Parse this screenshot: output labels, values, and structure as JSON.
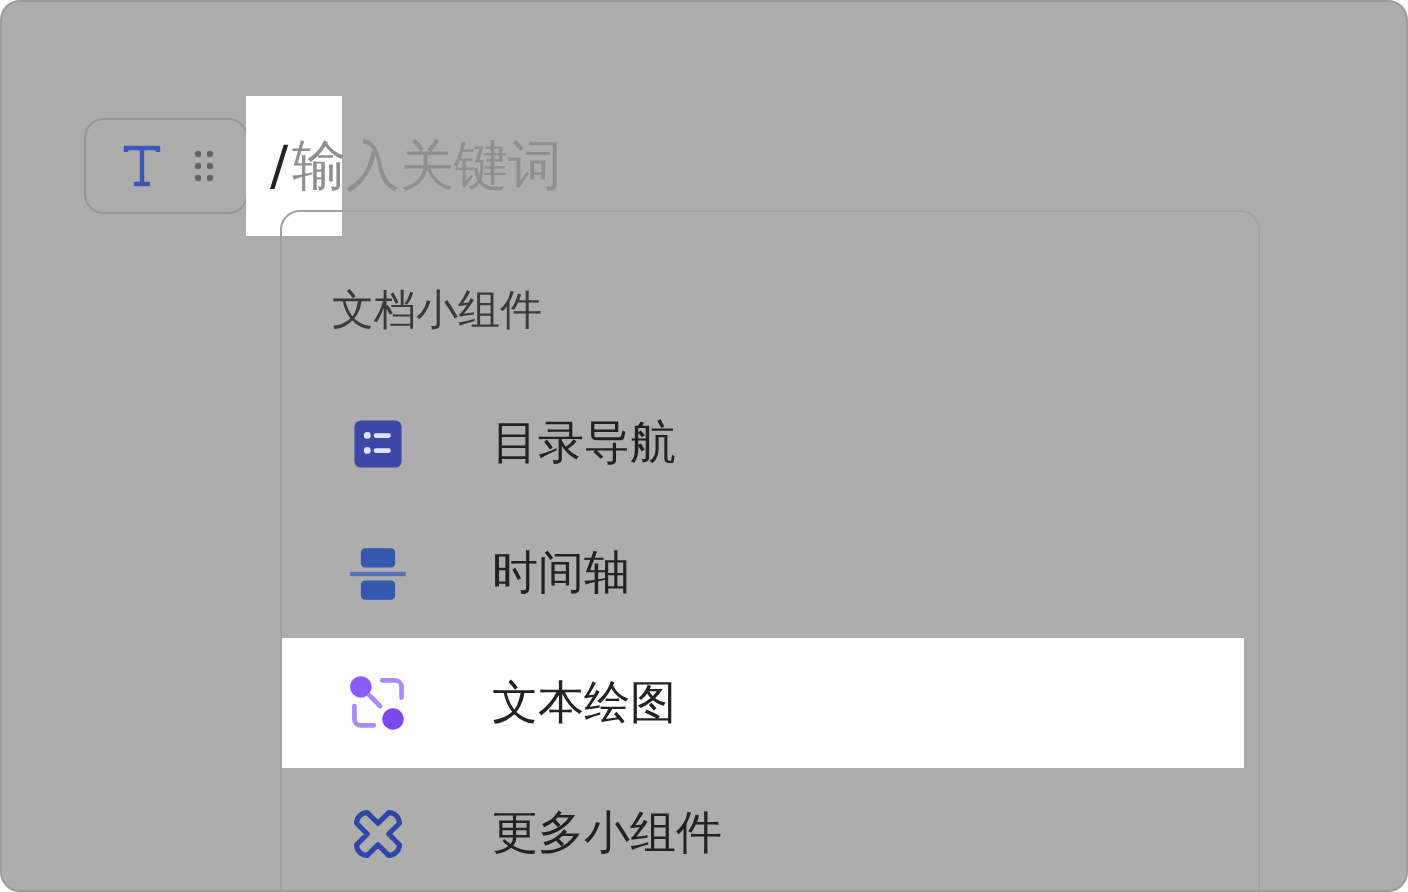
{
  "block_handle": {
    "kind": "text"
  },
  "slash_input": {
    "value": "/",
    "placeholder": "输入关键词"
  },
  "menu": {
    "heading": "文档小组件",
    "items": [
      {
        "label": "目录导航",
        "kind": "toc",
        "selected": false
      },
      {
        "label": "时间轴",
        "kind": "timeline",
        "selected": false
      },
      {
        "label": "文本绘图",
        "kind": "diagram",
        "selected": true
      },
      {
        "label": "更多小组件",
        "kind": "more",
        "selected": false
      }
    ]
  }
}
